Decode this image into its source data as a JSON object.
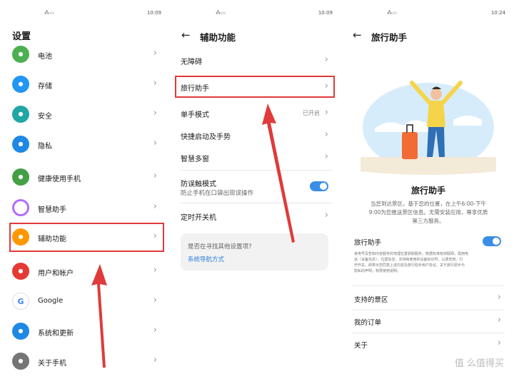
{
  "status_bar": {
    "left": "⁂ᵢₗₗ",
    "time1": "10:09",
    "time2": "10:09",
    "time3": "10:24"
  },
  "panel1": {
    "title": "设置",
    "items": [
      {
        "label": "电池",
        "icon": "battery-icon",
        "color": "#4caf50"
      },
      {
        "label": "存储",
        "icon": "storage-icon",
        "color": "#2196f3"
      },
      {
        "label": "安全",
        "icon": "shield-icon",
        "color": "#21a6a6"
      },
      {
        "label": "隐私",
        "icon": "privacy-shield-icon",
        "color": "#1e88e5"
      },
      {
        "label": "健康使用手机",
        "icon": "hourglass-icon",
        "color": "#43a047"
      },
      {
        "label": "智慧助手",
        "icon": "assistant-ring-icon",
        "color": "#b36bff"
      },
      {
        "label": "辅助功能",
        "icon": "hand-icon",
        "color": "#ff9800"
      },
      {
        "label": "用户和帐户",
        "icon": "user-icon",
        "color": "#e53935"
      },
      {
        "label": "Google",
        "icon": "google-icon",
        "color": "#ffffff"
      },
      {
        "label": "系统和更新",
        "icon": "phone-update-icon",
        "color": "#1e88e5"
      },
      {
        "label": "关于手机",
        "icon": "phone-icon",
        "color": "#757575"
      }
    ]
  },
  "panel2": {
    "title": "辅助功能",
    "items": [
      {
        "label": "无障碍"
      },
      {
        "label": "旅行助手"
      },
      {
        "label": "单手模式",
        "value": "已开启"
      },
      {
        "label": "快捷启动及手势"
      },
      {
        "label": "智慧多窗"
      },
      {
        "label": "防误触模式",
        "sub": "防止手机在口袋出现误操作"
      },
      {
        "label": "定时开关机"
      }
    ],
    "card_question": "是否在寻找其他设置项?",
    "card_link": "系统导航方式"
  },
  "panel3": {
    "title": "旅行助手",
    "heading": "旅行助手",
    "desc": [
      "当您到达景区，基于您的位置，在上午6:00-下午",
      "9:00为您推送景区信息。无需安装应用，尊享优质",
      "第三方服务。"
    ],
    "toggle_label": "旅行助手",
    "small_text": [
      "来电号及告知内容服务的地理位置获取服务，数据标准有效联网，需用电",
      "话（设备信息）、位置信息，支持和使用的设备标识符，以便告知、打",
      "开开关，即表示您同意上述内容及旅行助手用户协议、关于旅行助手与",
      "隐私的声明，权限使用说明。"
    ],
    "menu": [
      "支持的景区",
      "我的订单",
      "关于"
    ]
  },
  "watermark": "值 么值得买"
}
